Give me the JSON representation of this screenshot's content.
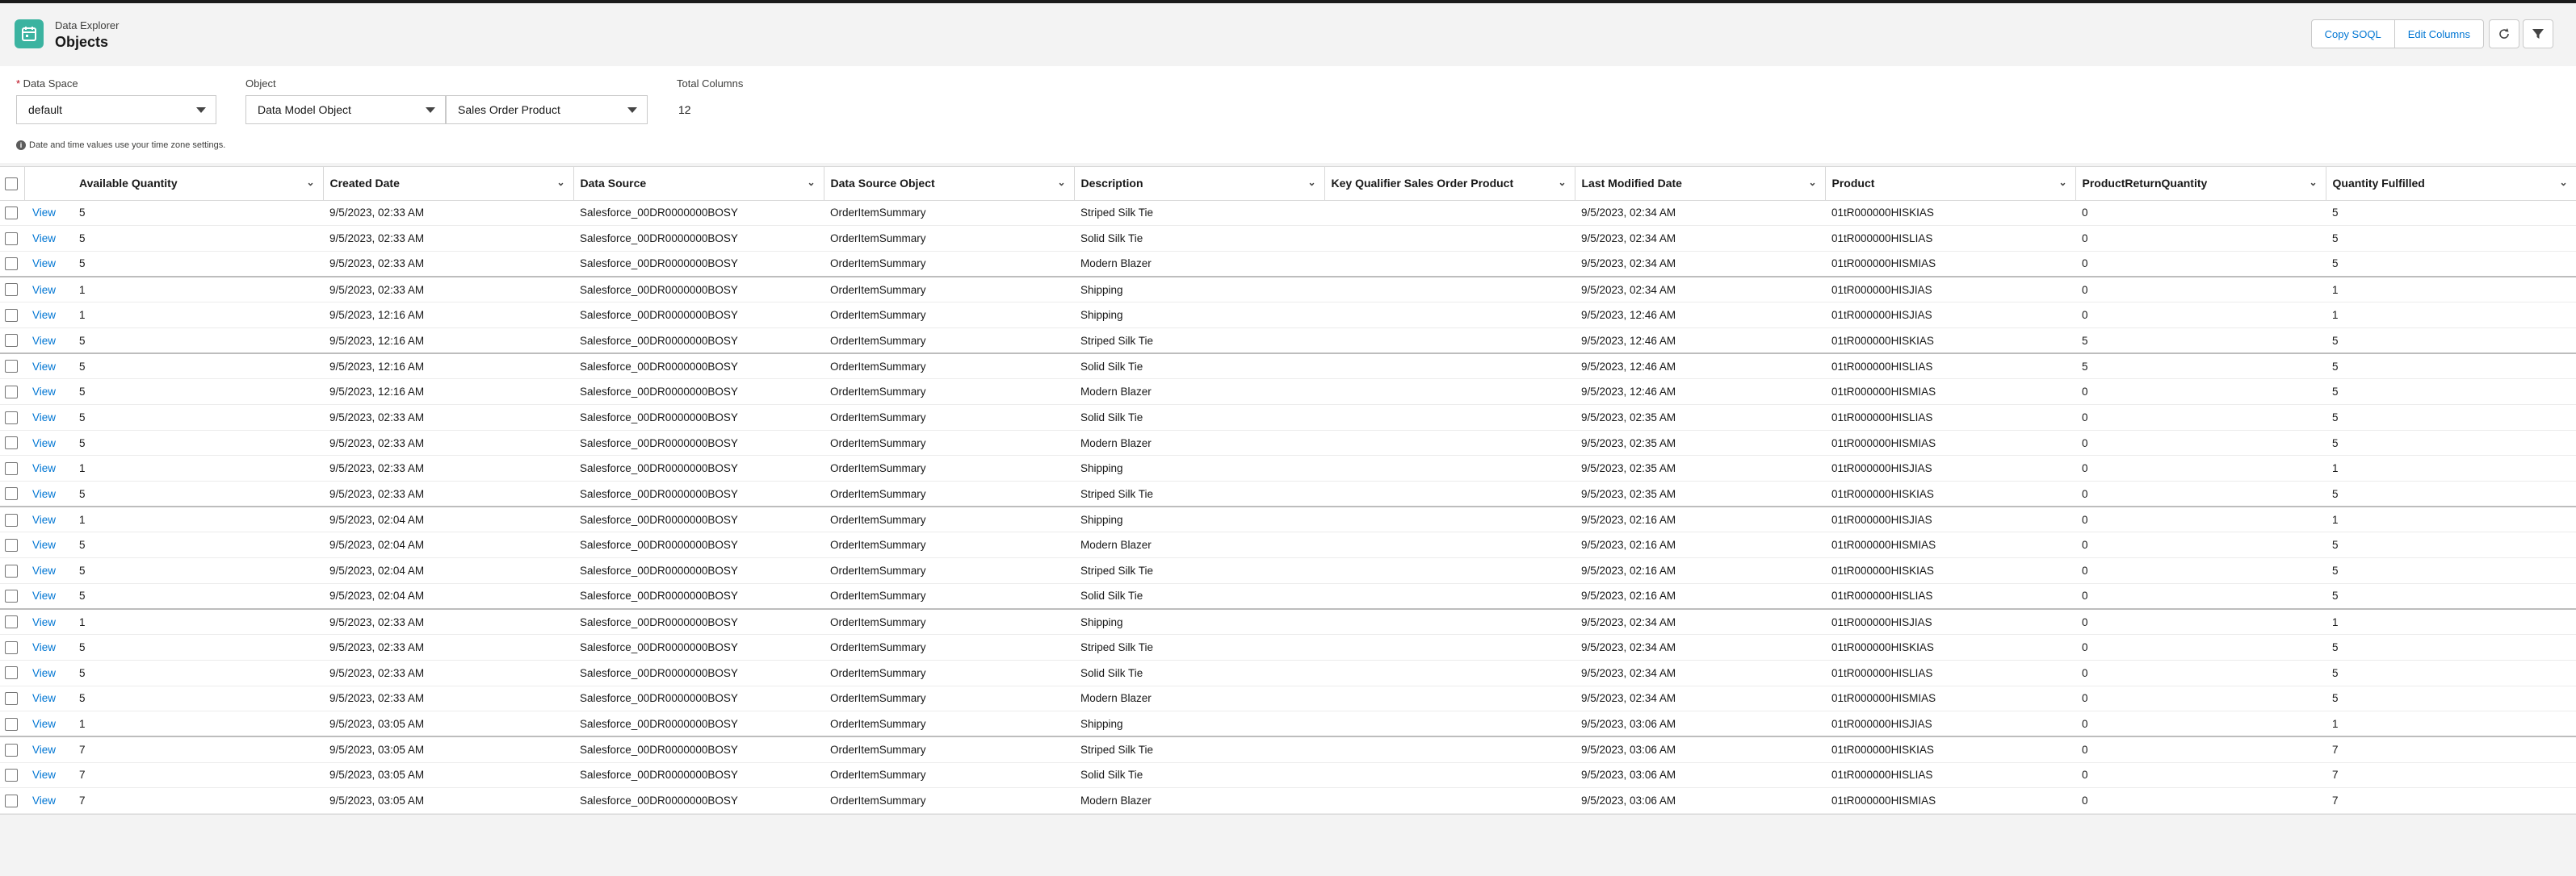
{
  "header": {
    "app_title": "Data Explorer",
    "page_title": "Objects",
    "copy_soql_label": "Copy SOQL",
    "edit_columns_label": "Edit Columns",
    "refresh_icon": "refresh-icon",
    "filter_icon": "filter-icon"
  },
  "filters": {
    "data_space_label": "Data Space",
    "data_space_value": "default",
    "object_label": "Object",
    "object_type_value": "Data Model Object",
    "object_value": "Sales Order Product",
    "total_columns_label": "Total Columns",
    "total_columns_value": "12",
    "timezone_note": "Date and time values use your time zone settings."
  },
  "table": {
    "view_label": "View",
    "columns": [
      "Available Quantity",
      "Created Date",
      "Data Source",
      "Data Source Object",
      "Description",
      "Key Qualifier Sales Order Product",
      "Last Modified Date",
      "Product",
      "ProductReturnQuantity",
      "Quantity Fulfilled"
    ],
    "rows": [
      [
        "5",
        "9/5/2023, 02:33 AM",
        "Salesforce_00DR0000000BOSY",
        "OrderItemSummary",
        "Striped Silk Tie",
        "",
        "9/5/2023, 02:34 AM",
        "01tR000000HISKIAS",
        "0",
        "5"
      ],
      [
        "5",
        "9/5/2023, 02:33 AM",
        "Salesforce_00DR0000000BOSY",
        "OrderItemSummary",
        "Solid Silk Tie",
        "",
        "9/5/2023, 02:34 AM",
        "01tR000000HISLIAS",
        "0",
        "5"
      ],
      [
        "5",
        "9/5/2023, 02:33 AM",
        "Salesforce_00DR0000000BOSY",
        "OrderItemSummary",
        "Modern Blazer",
        "",
        "9/5/2023, 02:34 AM",
        "01tR000000HISMIAS",
        "0",
        "5"
      ],
      [
        "1",
        "9/5/2023, 02:33 AM",
        "Salesforce_00DR0000000BOSY",
        "OrderItemSummary",
        "Shipping",
        "",
        "9/5/2023, 02:34 AM",
        "01tR000000HISJIAS",
        "0",
        "1"
      ],
      [
        "1",
        "9/5/2023, 12:16 AM",
        "Salesforce_00DR0000000BOSY",
        "OrderItemSummary",
        "Shipping",
        "",
        "9/5/2023, 12:46 AM",
        "01tR000000HISJIAS",
        "0",
        "1"
      ],
      [
        "5",
        "9/5/2023, 12:16 AM",
        "Salesforce_00DR0000000BOSY",
        "OrderItemSummary",
        "Striped Silk Tie",
        "",
        "9/5/2023, 12:46 AM",
        "01tR000000HISKIAS",
        "5",
        "5"
      ],
      [
        "5",
        "9/5/2023, 12:16 AM",
        "Salesforce_00DR0000000BOSY",
        "OrderItemSummary",
        "Solid Silk Tie",
        "",
        "9/5/2023, 12:46 AM",
        "01tR000000HISLIAS",
        "5",
        "5"
      ],
      [
        "5",
        "9/5/2023, 12:16 AM",
        "Salesforce_00DR0000000BOSY",
        "OrderItemSummary",
        "Modern Blazer",
        "",
        "9/5/2023, 12:46 AM",
        "01tR000000HISMIAS",
        "0",
        "5"
      ],
      [
        "5",
        "9/5/2023, 02:33 AM",
        "Salesforce_00DR0000000BOSY",
        "OrderItemSummary",
        "Solid Silk Tie",
        "",
        "9/5/2023, 02:35 AM",
        "01tR000000HISLIAS",
        "0",
        "5"
      ],
      [
        "5",
        "9/5/2023, 02:33 AM",
        "Salesforce_00DR0000000BOSY",
        "OrderItemSummary",
        "Modern Blazer",
        "",
        "9/5/2023, 02:35 AM",
        "01tR000000HISMIAS",
        "0",
        "5"
      ],
      [
        "1",
        "9/5/2023, 02:33 AM",
        "Salesforce_00DR0000000BOSY",
        "OrderItemSummary",
        "Shipping",
        "",
        "9/5/2023, 02:35 AM",
        "01tR000000HISJIAS",
        "0",
        "1"
      ],
      [
        "5",
        "9/5/2023, 02:33 AM",
        "Salesforce_00DR0000000BOSY",
        "OrderItemSummary",
        "Striped Silk Tie",
        "",
        "9/5/2023, 02:35 AM",
        "01tR000000HISKIAS",
        "0",
        "5"
      ],
      [
        "1",
        "9/5/2023, 02:04 AM",
        "Salesforce_00DR0000000BOSY",
        "OrderItemSummary",
        "Shipping",
        "",
        "9/5/2023, 02:16 AM",
        "01tR000000HISJIAS",
        "0",
        "1"
      ],
      [
        "5",
        "9/5/2023, 02:04 AM",
        "Salesforce_00DR0000000BOSY",
        "OrderItemSummary",
        "Modern Blazer",
        "",
        "9/5/2023, 02:16 AM",
        "01tR000000HISMIAS",
        "0",
        "5"
      ],
      [
        "5",
        "9/5/2023, 02:04 AM",
        "Salesforce_00DR0000000BOSY",
        "OrderItemSummary",
        "Striped Silk Tie",
        "",
        "9/5/2023, 02:16 AM",
        "01tR000000HISKIAS",
        "0",
        "5"
      ],
      [
        "5",
        "9/5/2023, 02:04 AM",
        "Salesforce_00DR0000000BOSY",
        "OrderItemSummary",
        "Solid Silk Tie",
        "",
        "9/5/2023, 02:16 AM",
        "01tR000000HISLIAS",
        "0",
        "5"
      ],
      [
        "1",
        "9/5/2023, 02:33 AM",
        "Salesforce_00DR0000000BOSY",
        "OrderItemSummary",
        "Shipping",
        "",
        "9/5/2023, 02:34 AM",
        "01tR000000HISJIAS",
        "0",
        "1"
      ],
      [
        "5",
        "9/5/2023, 02:33 AM",
        "Salesforce_00DR0000000BOSY",
        "OrderItemSummary",
        "Striped Silk Tie",
        "",
        "9/5/2023, 02:34 AM",
        "01tR000000HISKIAS",
        "0",
        "5"
      ],
      [
        "5",
        "9/5/2023, 02:33 AM",
        "Salesforce_00DR0000000BOSY",
        "OrderItemSummary",
        "Solid Silk Tie",
        "",
        "9/5/2023, 02:34 AM",
        "01tR000000HISLIAS",
        "0",
        "5"
      ],
      [
        "5",
        "9/5/2023, 02:33 AM",
        "Salesforce_00DR0000000BOSY",
        "OrderItemSummary",
        "Modern Blazer",
        "",
        "9/5/2023, 02:34 AM",
        "01tR000000HISMIAS",
        "0",
        "5"
      ],
      [
        "1",
        "9/5/2023, 03:05 AM",
        "Salesforce_00DR0000000BOSY",
        "OrderItemSummary",
        "Shipping",
        "",
        "9/5/2023, 03:06 AM",
        "01tR000000HISJIAS",
        "0",
        "1"
      ],
      [
        "7",
        "9/5/2023, 03:05 AM",
        "Salesforce_00DR0000000BOSY",
        "OrderItemSummary",
        "Striped Silk Tie",
        "",
        "9/5/2023, 03:06 AM",
        "01tR000000HISKIAS",
        "0",
        "7"
      ],
      [
        "7",
        "9/5/2023, 03:05 AM",
        "Salesforce_00DR0000000BOSY",
        "OrderItemSummary",
        "Solid Silk Tie",
        "",
        "9/5/2023, 03:06 AM",
        "01tR000000HISLIAS",
        "0",
        "7"
      ],
      [
        "7",
        "9/5/2023, 03:05 AM",
        "Salesforce_00DR0000000BOSY",
        "OrderItemSummary",
        "Modern Blazer",
        "",
        "9/5/2023, 03:06 AM",
        "01tR000000HISMIAS",
        "0",
        "7"
      ]
    ],
    "divider_rows": [
      3,
      6,
      12,
      16,
      21
    ]
  }
}
